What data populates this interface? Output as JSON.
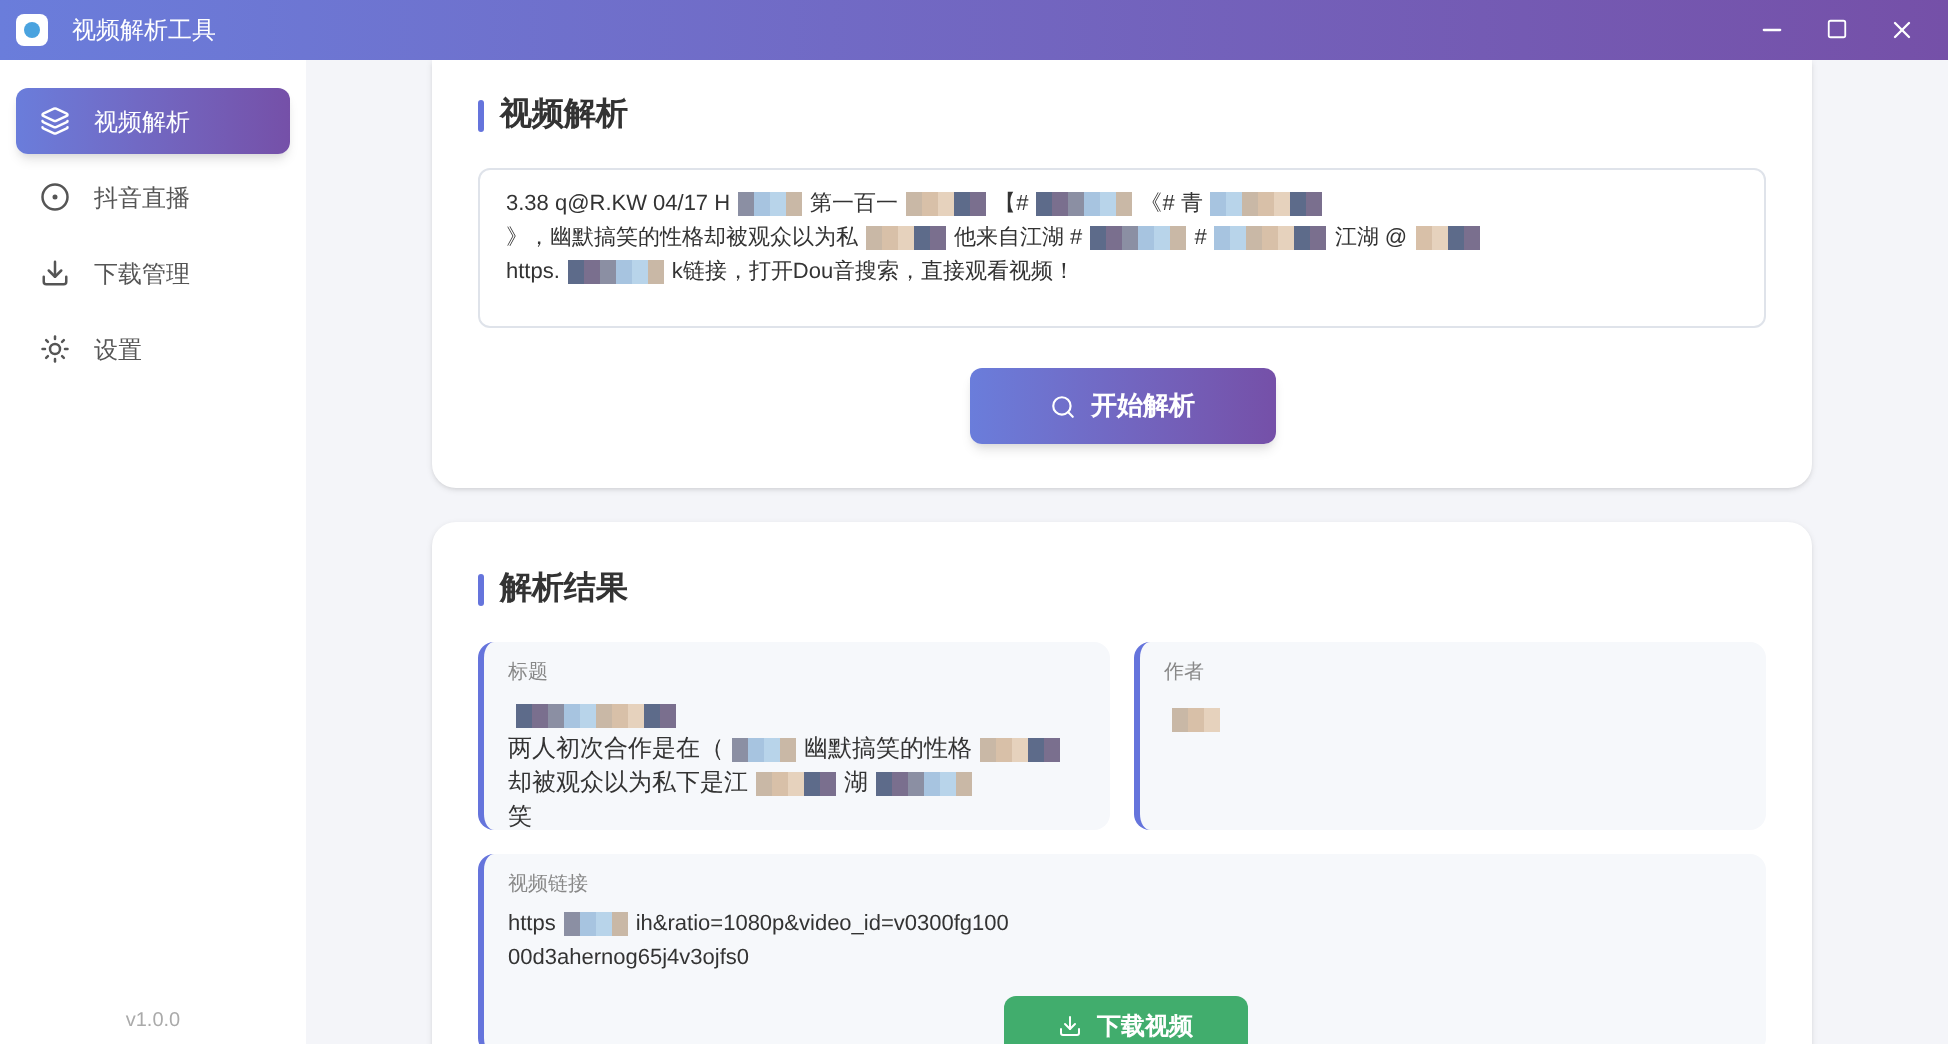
{
  "window": {
    "title": "视频解析工具"
  },
  "sidebar": {
    "items": [
      {
        "label": "视频解析",
        "kind": "layers",
        "selected": true
      },
      {
        "label": "抖音直播",
        "kind": "live",
        "selected": false
      },
      {
        "label": "下载管理",
        "kind": "download",
        "selected": false
      },
      {
        "label": "设置",
        "kind": "settings",
        "selected": false
      }
    ],
    "version": "v1.0.0"
  },
  "parse_card": {
    "title": "视频解析",
    "input_lines": [
      [
        "3.38 q@R.KW 04/17 H",
        "第一百一",
        "【#",
        "《# 青"
      ],
      [
        "》，幽默搞笑的性格却被观众以为私",
        "他来自江湖 #",
        "#",
        "江湖 @"
      ],
      [
        "https.",
        "k链接，打开Dou音搜索，直接观看视频！"
      ]
    ],
    "button": "开始解析"
  },
  "result_card": {
    "title": "解析结果",
    "title_field": {
      "label": "标题",
      "lines": [
        [
          "两人初次合作是在（",
          "幽默搞笑的性格"
        ],
        [
          "却被观众以为私下是江",
          "湖"
        ],
        [
          "笑"
        ]
      ]
    },
    "author_field": {
      "label": "作者"
    },
    "link_field": {
      "label": "视频链接",
      "lines": [
        [
          "https",
          "ih&ratio=1080p&video_id=v0300fg100"
        ],
        [
          "00d3ahernog65j4v3ojfs0"
        ]
      ]
    },
    "button": "下载视频"
  }
}
